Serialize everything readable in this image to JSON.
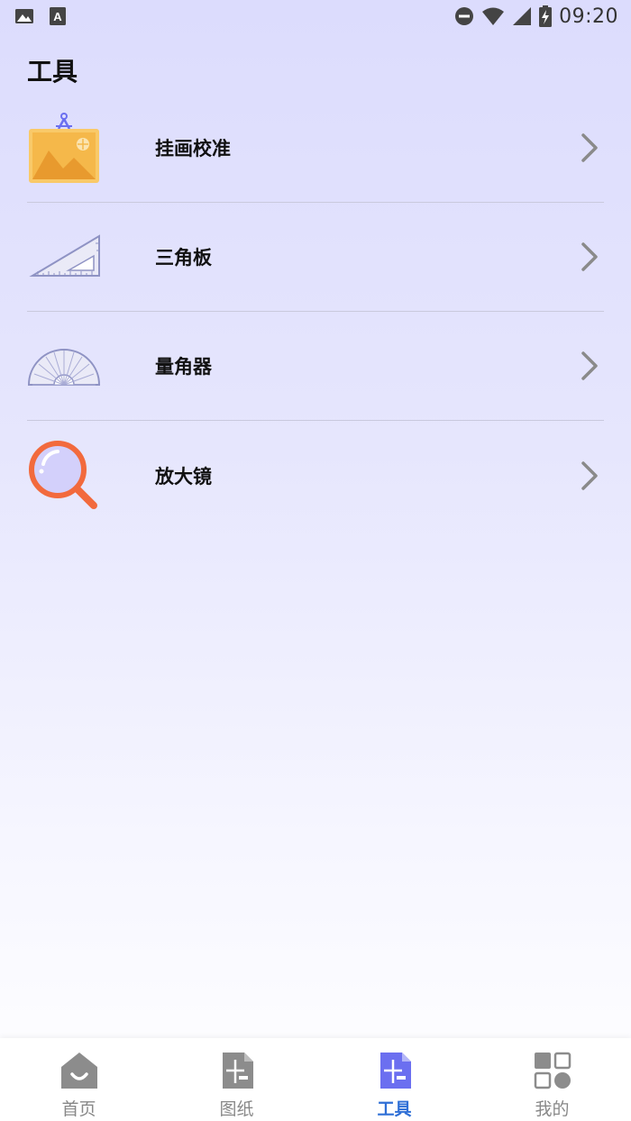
{
  "status_bar": {
    "time": "09:20"
  },
  "page": {
    "title": "工具"
  },
  "tools": [
    {
      "label": "挂画校准",
      "icon": "picture-calibrate-icon"
    },
    {
      "label": "三角板",
      "icon": "triangle-ruler-icon"
    },
    {
      "label": "量角器",
      "icon": "protractor-icon"
    },
    {
      "label": "放大镜",
      "icon": "magnifier-icon"
    }
  ],
  "bottom_nav": {
    "items": [
      {
        "label": "首页",
        "icon": "home-icon",
        "active": false
      },
      {
        "label": "图纸",
        "icon": "drawing-icon",
        "active": false
      },
      {
        "label": "工具",
        "icon": "tools-icon",
        "active": true
      },
      {
        "label": "我的",
        "icon": "profile-icon",
        "active": false
      }
    ]
  },
  "colors": {
    "accent": "#2f6fd6",
    "active_icon": "#6b6ff0",
    "inactive_icon": "#8c8c8c",
    "magnifier": "#f26a3d",
    "picture_frame": "#f5b84a"
  }
}
